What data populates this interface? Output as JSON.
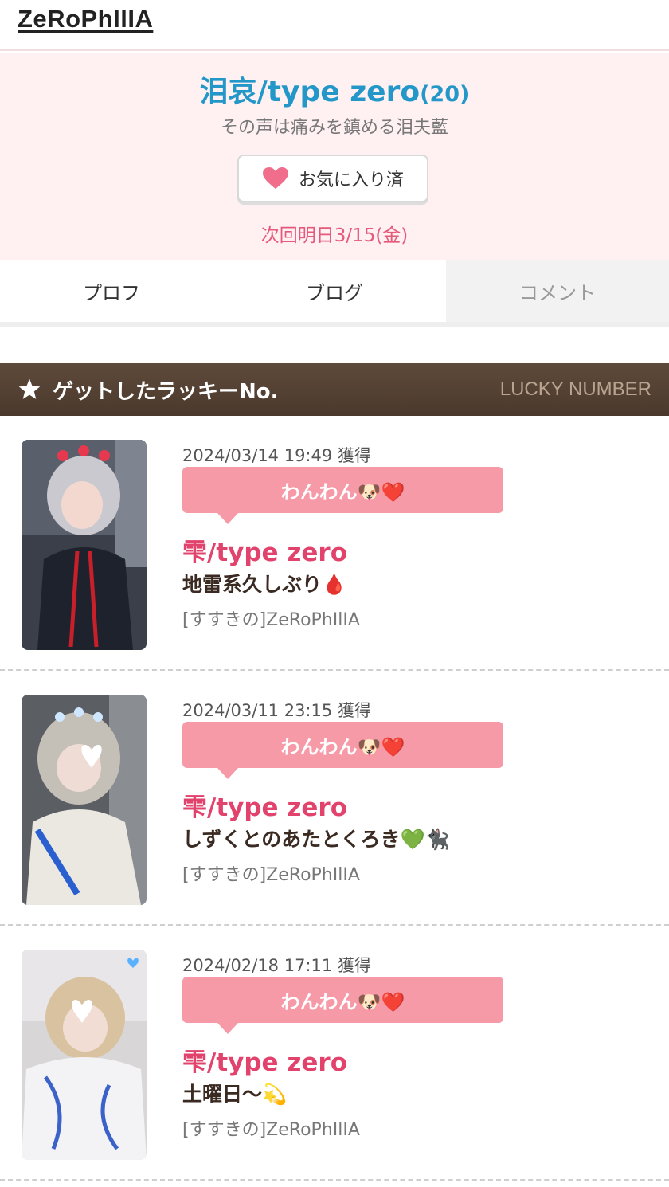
{
  "site": {
    "logo": "ZeRoPhIlIA"
  },
  "profile": {
    "name": "泪哀/type zero",
    "age": "(20)",
    "catchphrase": "その声は痛みを鎮める泪夫藍",
    "favorite_label": "お気に入り済",
    "next_schedule": "次回明日3/15(金)",
    "accent_color": "#2497c9",
    "heart_color": "#f06e8c"
  },
  "tabs": [
    {
      "label": "プロフ",
      "active": true
    },
    {
      "label": "ブログ",
      "active": true
    },
    {
      "label": "コメント",
      "active": false
    }
  ],
  "section": {
    "title": "ゲットしたラッキーNo.",
    "subtitle": "LUCKY NUMBER",
    "icon": "star-icon"
  },
  "entries": [
    {
      "date": "2024/03/14 19:49 獲得",
      "lucky": "わんわん🐶❤️",
      "cast": "雫/type zero",
      "title": "地雷系久しぶり🩸",
      "store": "[すすきの]ZeRoPhIlIA"
    },
    {
      "date": "2024/03/11 23:15 獲得",
      "lucky": "わんわん🐶❤️",
      "cast": "雫/type zero",
      "title": "しずくとのあたとくろき💚🐈‍⬛",
      "store": "[すすきの]ZeRoPhIlIA"
    },
    {
      "date": "2024/02/18 17:11 獲得",
      "lucky": "わんわん🐶❤️",
      "cast": "雫/type zero",
      "title": "土曜日〜💫",
      "store": "[すすきの]ZeRoPhIlIA"
    }
  ]
}
